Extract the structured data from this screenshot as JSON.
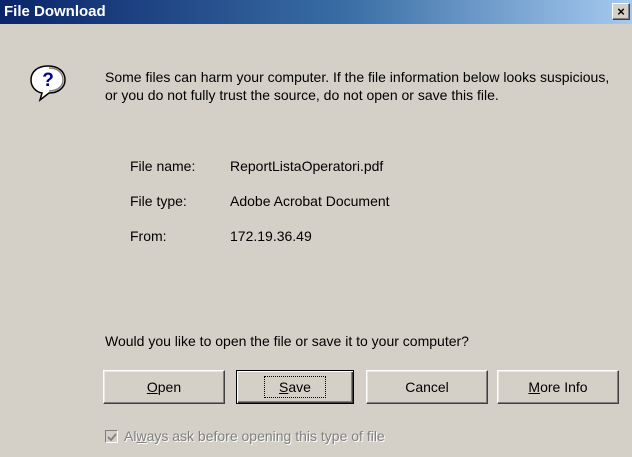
{
  "dialog": {
    "title": "File Download",
    "close_label": "×",
    "warning": "Some files can harm your computer. If the file information below looks suspicious, or you do not fully trust the source, do not open or save this file.",
    "file_name_label": "File name:",
    "file_name": "ReportListaOperatori.pdf",
    "file_type_label": "File type:",
    "file_type": "Adobe Acrobat Document",
    "from_label": "From:",
    "from": "172.19.36.49",
    "question": "Would you like to open the file or save it to your computer?",
    "buttons": {
      "open": {
        "mnemonic": "O",
        "rest": "pen"
      },
      "save": {
        "mnemonic": "S",
        "rest": "ave"
      },
      "cancel": "Cancel",
      "more_info": {
        "mnemonic": "M",
        "rest": "ore Info"
      }
    },
    "checkbox": {
      "before": "Al",
      "mnemonic": "w",
      "after": "ays ask before opening this type of file",
      "checked": true,
      "enabled": false
    },
    "icon": "question-icon"
  }
}
